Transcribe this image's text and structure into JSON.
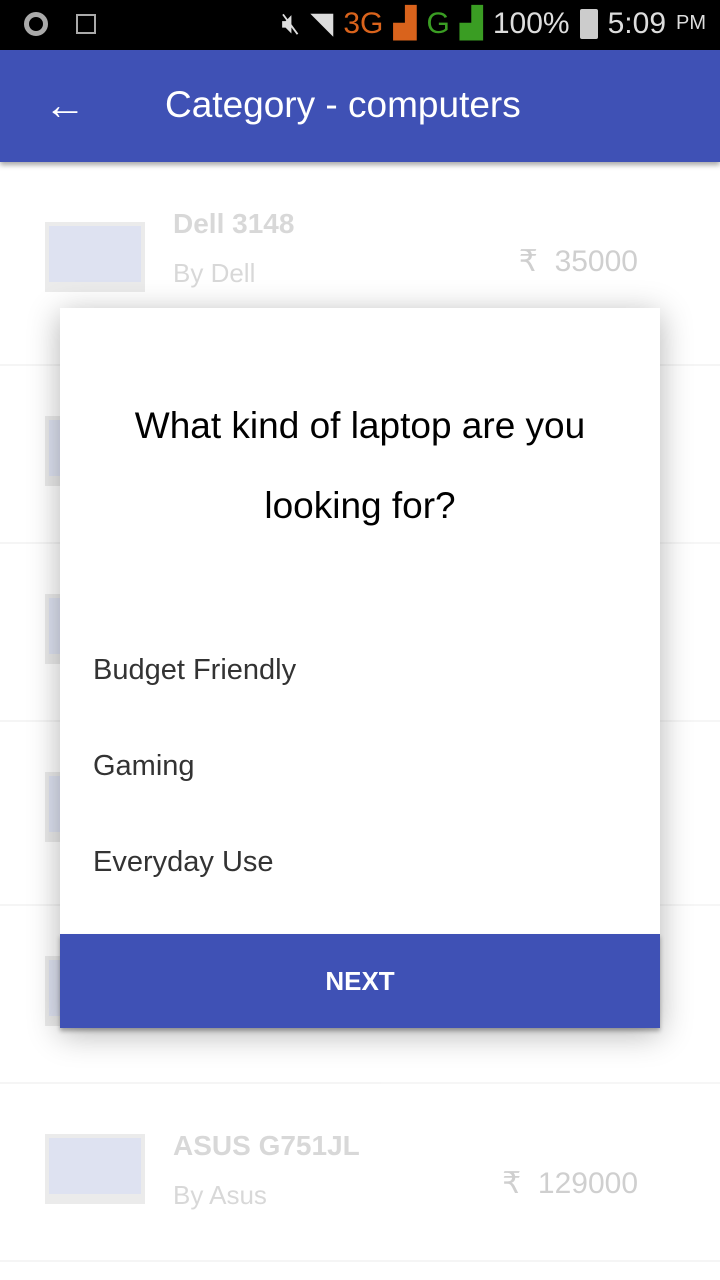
{
  "status_bar": {
    "network_3g": "3G",
    "network_g": "G",
    "battery": "100%",
    "time": "5:09",
    "ampm": "PM"
  },
  "app_bar": {
    "title": "Category - computers",
    "back_icon": "arrow-left-icon"
  },
  "products": [
    {
      "name": "Dell 3148",
      "brand": "By Dell",
      "currency": "₹",
      "price": "35000"
    },
    {
      "name": "",
      "brand": "",
      "currency": "",
      "price": ""
    },
    {
      "name": "",
      "brand": "",
      "currency": "",
      "price": ""
    },
    {
      "name": "",
      "brand": "",
      "currency": "",
      "price": ""
    },
    {
      "name": "",
      "brand": "",
      "currency": "",
      "price": ""
    },
    {
      "name": "ASUS G751JL",
      "brand": "By Asus",
      "currency": "₹",
      "price": "129000"
    }
  ],
  "dialog": {
    "question": "What kind of laptop are you looking for?",
    "options": [
      "Budget Friendly",
      "Gaming",
      "Everyday Use"
    ],
    "next_label": "NEXT"
  },
  "colors": {
    "primary": "#3f51b5"
  }
}
